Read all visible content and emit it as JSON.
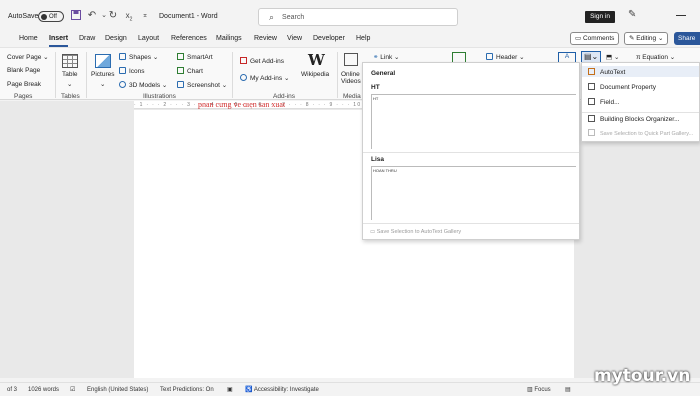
{
  "titlebar": {
    "autosave_label": "AutoSave",
    "autosave_state": "Off",
    "doc_title": "Document1 - Word",
    "search_placeholder": "Search",
    "signin_label": "Sign in"
  },
  "menu": {
    "tabs": [
      "Home",
      "Insert",
      "Draw",
      "Design",
      "Layout",
      "References",
      "Mailings",
      "Review",
      "View",
      "Developer",
      "Help"
    ],
    "active_tab": "Insert",
    "comments_label": "Comments",
    "editing_label": "Editing",
    "share_label": "Share"
  },
  "ribbon": {
    "pages": {
      "items": [
        "Cover Page",
        "Blank Page",
        "Page Break"
      ],
      "group": "Pages"
    },
    "tables": {
      "label": "Table",
      "group": "Tables"
    },
    "illustrations": {
      "pictures": "Pictures",
      "shapes": "Shapes",
      "icons": "Icons",
      "models": "3D Models",
      "smartart": "SmartArt",
      "chart": "Chart",
      "screenshot": "Screenshot",
      "group": "Illustrations"
    },
    "addins": {
      "get": "Get Add-ins",
      "my": "My Add-ins",
      "wikipedia": "Wikipedia",
      "group": "Add-ins"
    },
    "media": {
      "online": "Online",
      "videos": "Videos",
      "group": "Media"
    },
    "links": {
      "link": "Link"
    },
    "header": "Header",
    "equation": "Equation"
  },
  "ruler": {
    "marks": "· 1 · · · 2 · · · 3 · · · 4 · · · 5 · · · 6 · · · 7 · · · 8 · · · 9 · · · 10 · · · 11 · · · 12"
  },
  "document": {
    "visible_text": "phần cứng về điện sản xuất"
  },
  "autotext_gallery": {
    "heading": "General",
    "entries": [
      {
        "name": "HT",
        "preview": "HT"
      },
      {
        "name": "Lisa",
        "preview": "HOAN THRU"
      }
    ],
    "save_label": "Save Selection to AutoText Gallery"
  },
  "quick_parts_menu": {
    "items": [
      "AutoText",
      "Document Property",
      "Field...",
      "Building Blocks Organizer...",
      "Save Selection to Quick Part Gallery..."
    ],
    "highlighted": "AutoText"
  },
  "statusbar": {
    "page": "of 3",
    "words": "1026 words",
    "language": "English (United States)",
    "predictions": "Text Predictions: On",
    "accessibility": "Accessibility: Investigate",
    "focus": "Focus"
  },
  "watermark": "mytour.vn",
  "colors": {
    "accent": "#2b579a",
    "doc_text": "#d32f2f"
  }
}
